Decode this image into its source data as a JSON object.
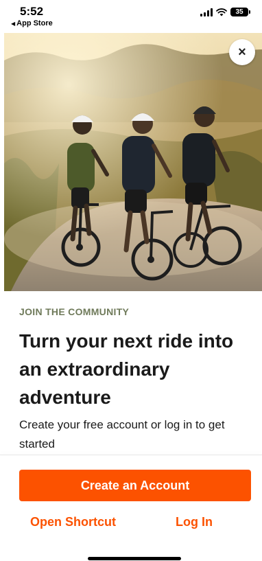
{
  "status_bar": {
    "time": "5:52",
    "back_app": "App Store",
    "battery": "35"
  },
  "hero": {
    "image": "cyclists-riding-gravel-road-photo"
  },
  "close_icon": "×",
  "content": {
    "eyebrow": "JOIN THE COMMUNITY",
    "headline": "Turn your next ride into an extraordinary adventure",
    "subtext": "Create your free account or log in to get started"
  },
  "actions": {
    "create_account": "Create an Account",
    "open_shortcut": "Open Shortcut",
    "log_in": "Log In"
  },
  "colors": {
    "accent": "#fc5200",
    "eyebrow": "#6f7a5a"
  }
}
